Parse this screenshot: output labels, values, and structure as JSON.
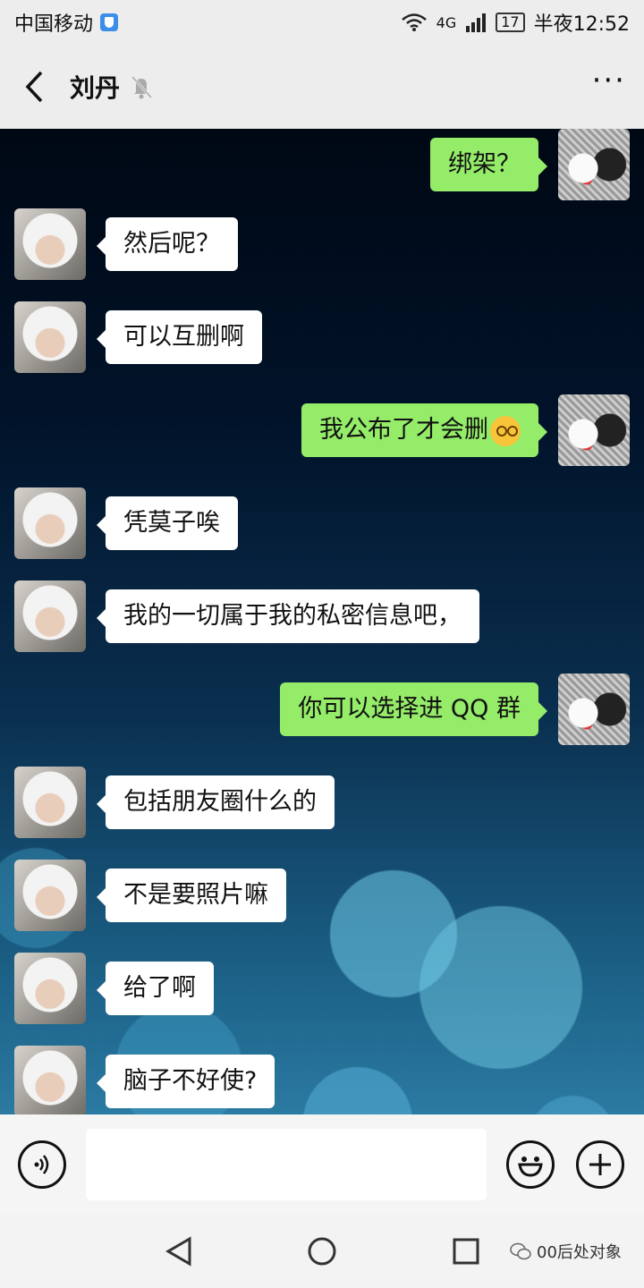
{
  "status": {
    "carrier": "中国移动",
    "network": "4G",
    "battery": "17",
    "time": "半夜12:52"
  },
  "header": {
    "title": "刘丹"
  },
  "messages": [
    {
      "side": "out",
      "text": "绑架？"
    },
    {
      "side": "in",
      "text": "然后呢？"
    },
    {
      "side": "in",
      "text": "可以互删啊"
    },
    {
      "side": "out",
      "text": "我公布了才会删"
    },
    {
      "side": "in",
      "text": "凭莫子唉"
    },
    {
      "side": "in",
      "text": "我的一切属于我的私密信息吧，"
    },
    {
      "side": "out",
      "text": "你可以选择进 QQ 群"
    },
    {
      "side": "in",
      "text": "包括朋友圈什么的"
    },
    {
      "side": "in",
      "text": "不是要照片嘛"
    },
    {
      "side": "in",
      "text": "给了啊"
    },
    {
      "side": "in",
      "text": "脑子不好使?"
    }
  ],
  "input": {
    "value": ""
  },
  "watermark": {
    "text": "00后处对象"
  },
  "colors": {
    "outgoing_bubble": "#95ec69",
    "incoming_bubble": "#ffffff",
    "bar": "#ededed"
  },
  "icons": {
    "voice": "voice-icon",
    "emoji": "emoji-icon",
    "plus": "plus-icon",
    "back": "back-icon",
    "mute": "mute-icon",
    "more": "more-icon"
  }
}
